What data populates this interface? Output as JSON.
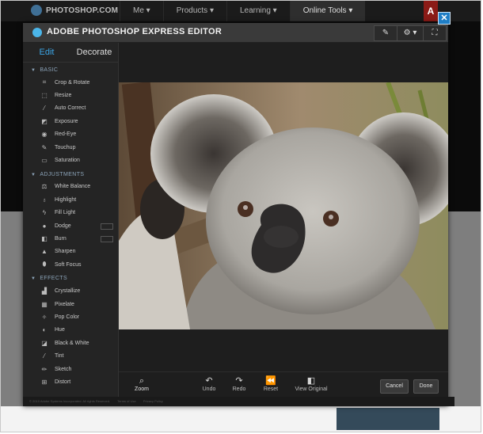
{
  "site": {
    "logo_text": "PHOTOSHOP.COM",
    "nav": [
      "Me ▾",
      "Products ▾",
      "Learning ▾",
      "Online Tools ▾"
    ],
    "adobe_tag": "A",
    "close": "✕"
  },
  "editor": {
    "title": "ADOBE PHOTOSHOP EXPRESS EDITOR",
    "tabs": {
      "edit": "Edit",
      "decorate": "Decorate"
    },
    "sections": {
      "basic": {
        "label": "BASIC",
        "items": [
          "Crop & Rotate",
          "Resize",
          "Auto Correct",
          "Exposure",
          "Red-Eye",
          "Touchup",
          "Saturation"
        ]
      },
      "adjustments": {
        "label": "ADJUSTMENTS",
        "items": [
          "White Balance",
          "Highlight",
          "Fill Light",
          "Dodge",
          "Burn",
          "Sharpen",
          "Soft Focus"
        ]
      },
      "effects": {
        "label": "EFFECTS",
        "items": [
          "Crystallize",
          "Pixelate",
          "Pop Color",
          "Hue",
          "Black & White",
          "Tint",
          "Sketch",
          "Distort"
        ]
      }
    },
    "bottom_bar": {
      "zoom": "Zoom",
      "undo": "Undo",
      "redo": "Redo",
      "reset": "Reset",
      "view_original": "View Original",
      "cancel": "Cancel",
      "done": "Done"
    },
    "footer": {
      "copyright": "© 2010 Adobe Systems Incorporated. All rights Reserved.",
      "terms": "Terms of Use",
      "privacy": "Privacy Policy"
    }
  },
  "colors": {
    "accent": "#3ba5e6",
    "header": "#3a3a3a",
    "panel": "#242424"
  }
}
